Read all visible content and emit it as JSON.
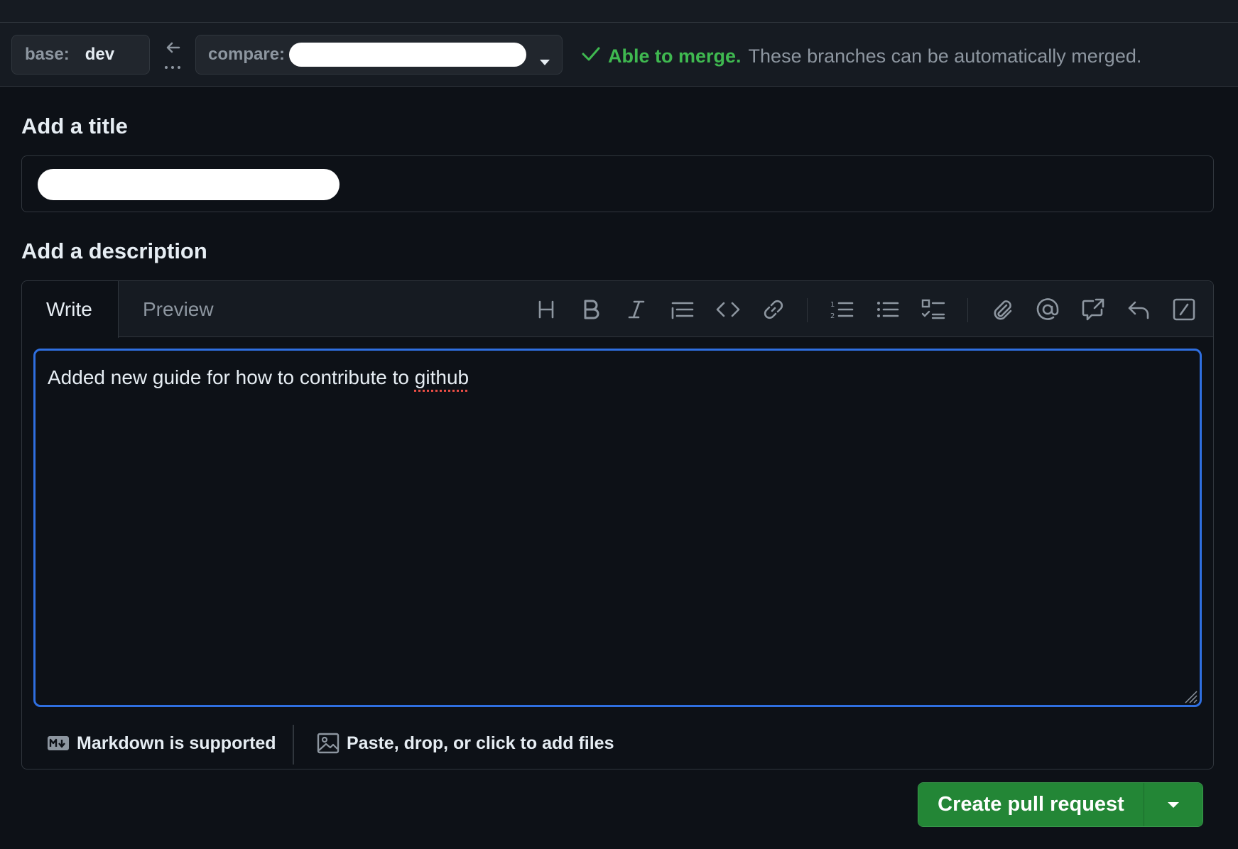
{
  "range": {
    "base_label": "base:",
    "base_value": "dev",
    "compare_label": "compare:",
    "merge_ok": "Able to merge.",
    "merge_msg": "These branches can be automatically merged."
  },
  "title_section": {
    "label": "Add a title"
  },
  "description_section": {
    "label": "Add a description",
    "tabs": [
      "Write",
      "Preview"
    ],
    "active_tab": "Write",
    "text_before": "Added new guide for how to contribute to ",
    "text_misspelled": "github",
    "toolbar_icons": [
      "heading-icon",
      "bold-icon",
      "italic-icon",
      "quote-icon",
      "code-icon",
      "link-icon",
      "ordered-list-icon",
      "unordered-list-icon",
      "task-list-icon",
      "attach-icon",
      "mention-icon",
      "cross-reference-icon",
      "reply-icon",
      "slash-commands-icon"
    ]
  },
  "footer": {
    "markdown": "Markdown is supported",
    "files": "Paste, drop, or click to add files"
  },
  "actions": {
    "create": "Create pull request"
  },
  "colors": {
    "background": "#0d1117",
    "success": "#3fb950",
    "button_green": "#238636",
    "focus_blue": "#2f6fe0"
  }
}
